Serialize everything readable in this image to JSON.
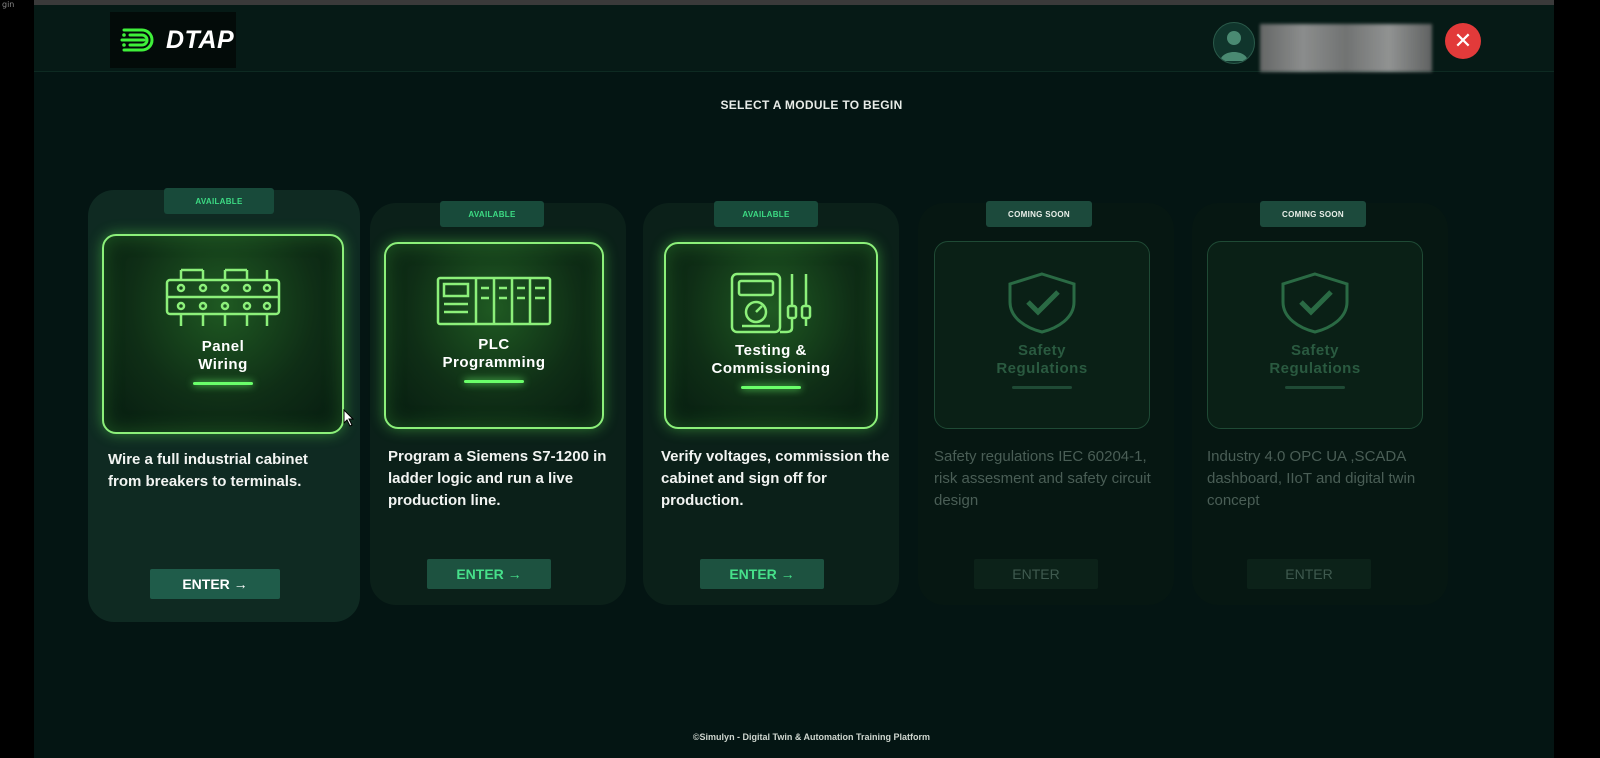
{
  "corner_text": "gin",
  "header": {
    "logo_text": "DTAP",
    "close_glyph": "✕"
  },
  "page_title": "SELECT A MODULE TO BEGIN",
  "modules": [
    {
      "badge": "AVAILABLE",
      "icon": "terminal-block-icon",
      "title": "Panel\nWiring",
      "description": "Wire a full industrial cabinet from breakers to terminals.",
      "button": "ENTER →"
    },
    {
      "badge": "AVAILABLE",
      "icon": "plc-rack-icon",
      "title": "PLC\nProgramming",
      "description": "Program a Siemens S7-1200 in ladder logic and run a live production line.",
      "button": "ENTER →"
    },
    {
      "badge": "AVAILABLE",
      "icon": "multimeter-icon",
      "title": "Testing &\nCommissioning",
      "description": "Verify voltages, commission the cabinet and sign off for production.",
      "button": "ENTER →"
    },
    {
      "badge": "COMING SOON",
      "icon": "shield-check-icon",
      "title": "Safety\nRegulations",
      "description": "Safety regulations IEC 60204-1, risk assesment and safety circuit design",
      "button": "ENTER"
    },
    {
      "badge": "COMING SOON",
      "icon": "shield-check-icon",
      "title": "Safety\nRegulations",
      "description": "Industry 4.0 OPC UA ,SCADA dashboard, IIoT and digital twin concept",
      "button": "ENTER"
    }
  ],
  "footer": "©Simulyn  -  Digital Twin & Automation Training Platform",
  "colors": {
    "accent_green": "#8cf07a",
    "close_red": "#e23a3a",
    "background": "#041513"
  }
}
